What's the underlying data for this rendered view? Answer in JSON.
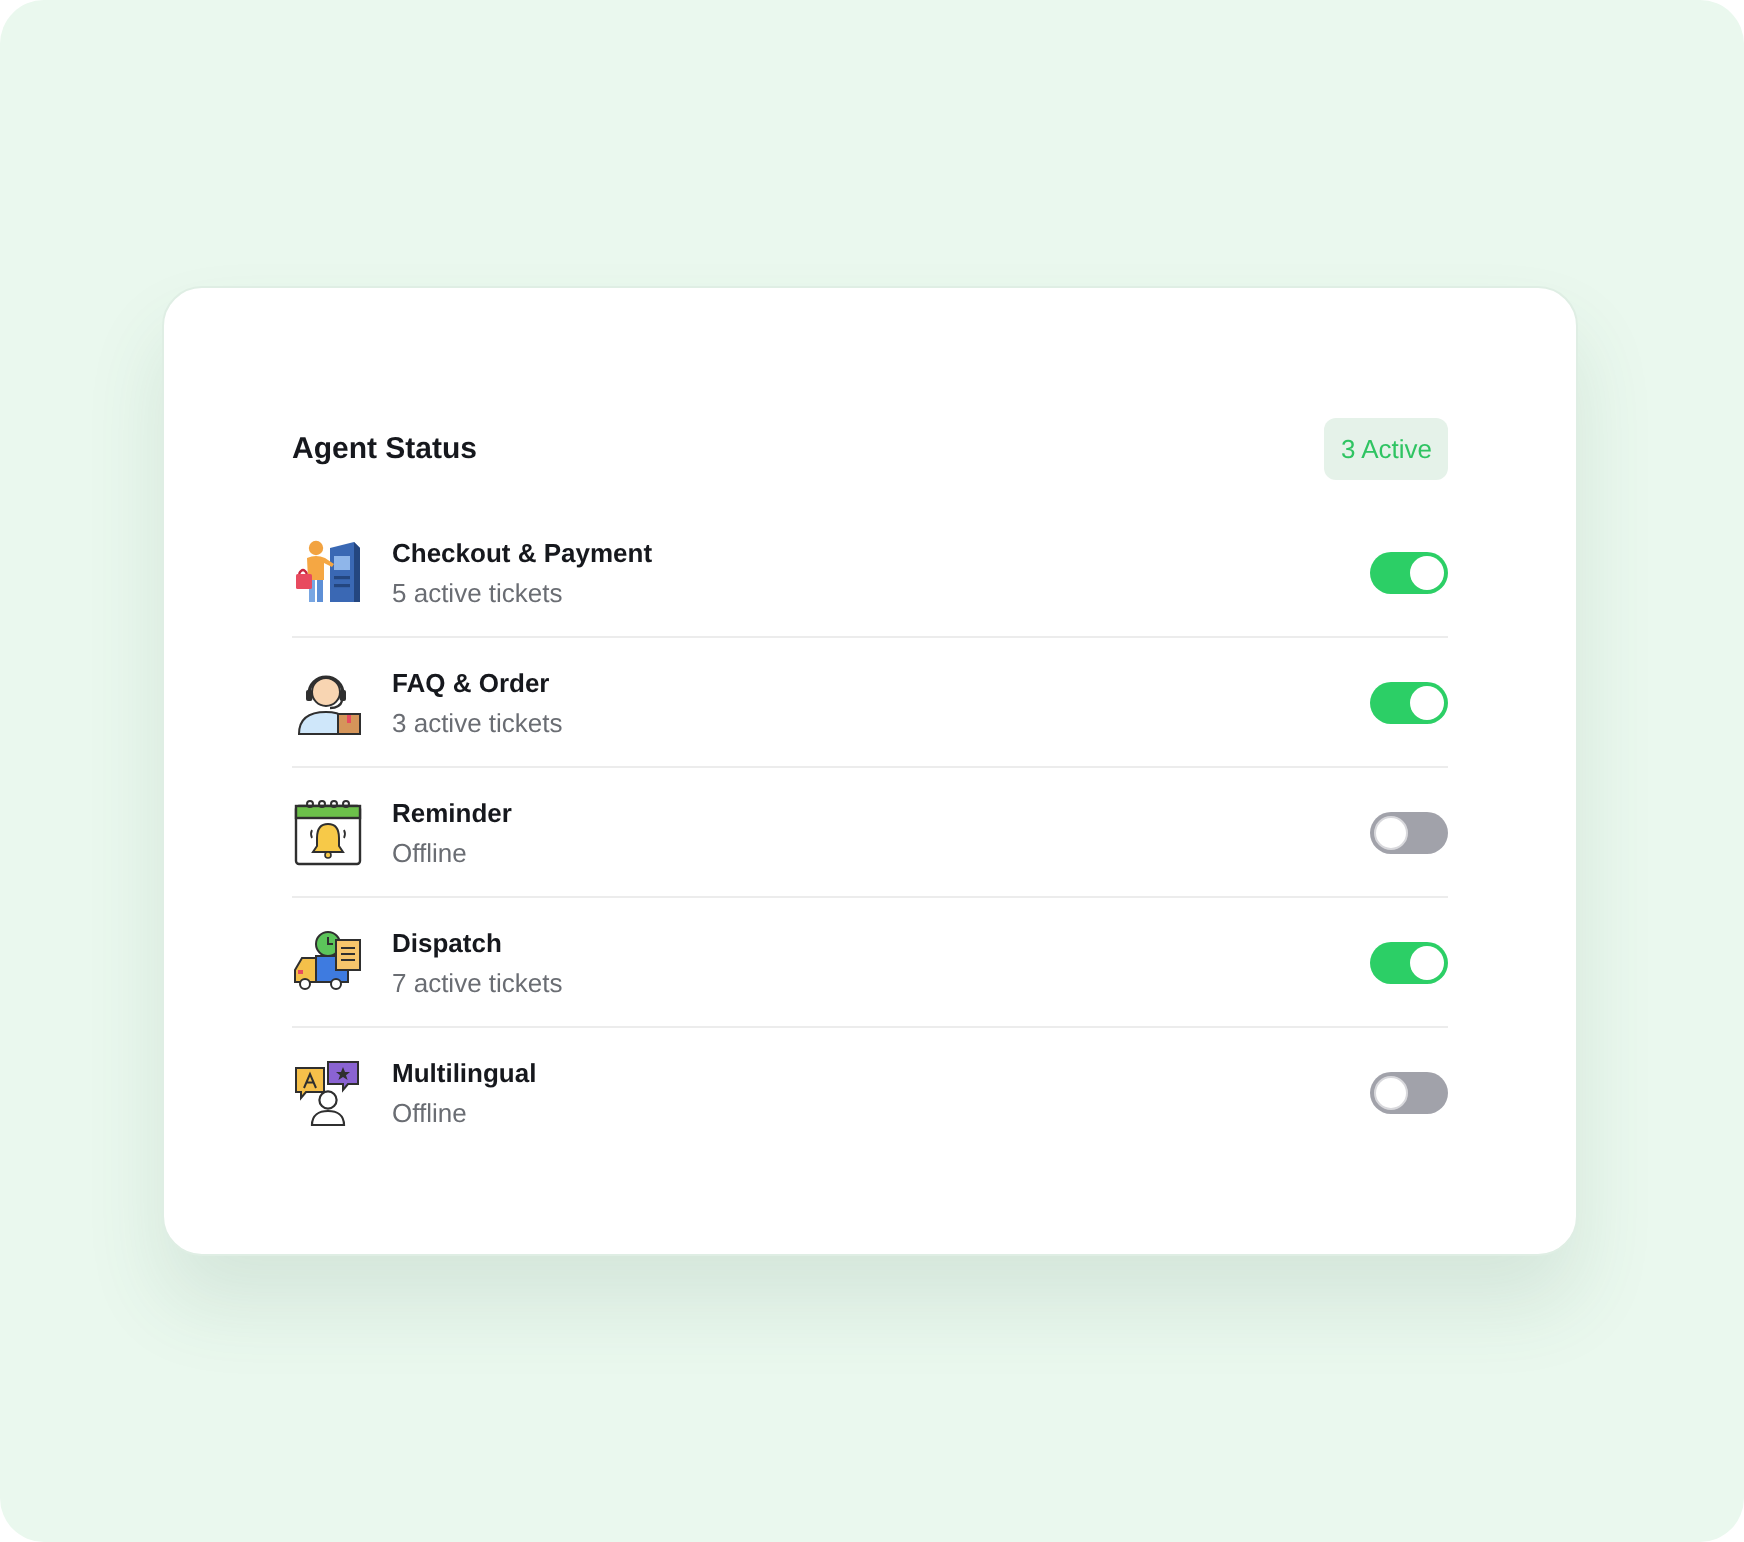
{
  "card": {
    "title": "Agent Status",
    "badge": "3 Active"
  },
  "agents": [
    {
      "name": "Checkout & Payment",
      "status": "5 active tickets",
      "on": true
    },
    {
      "name": "FAQ & Order",
      "status": "3 active tickets",
      "on": true
    },
    {
      "name": "Reminder",
      "status": "Offline",
      "on": false
    },
    {
      "name": "Dispatch",
      "status": "7 active tickets",
      "on": true
    },
    {
      "name": "Multilingual",
      "status": "Offline",
      "on": false
    }
  ]
}
